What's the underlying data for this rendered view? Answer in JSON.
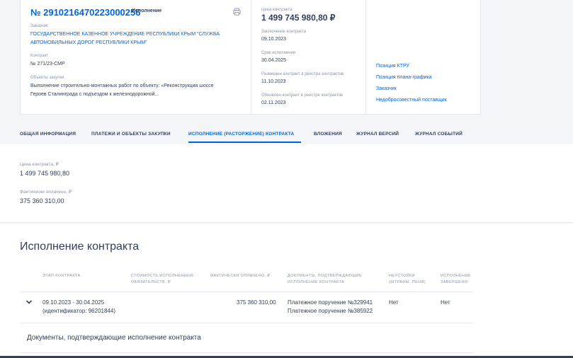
{
  "contract": {
    "number": "№ 2910216470223000256",
    "status": "Исполнение",
    "customer_label": "Заказчик",
    "customer_name_line1": "ГОСУДАРСТВЕННОЕ КАЗЕННОЕ УЧРЕЖДЕНИЕ РЕСПУБЛИКИ КРЫМ \"СЛУЖБА",
    "customer_name_line2": "АВТОМОБИЛЬНЫХ ДОРОГ РЕСПУБЛИКИ КРЫМ\"",
    "contract_label": "Контракт",
    "contract_value": "№ 271/23-СМР",
    "objects_label": "Объекты закупки",
    "objects_line1": "Выполнение строительно-монтажных работ по объекту: «Реконструкция шоссе",
    "objects_line2": "Героев Сталинграда с подъездом к железнодорожной..."
  },
  "details": {
    "price_label": "Цена контракта",
    "price_value": "1 499 745 980,80 ₽",
    "concluded_label": "Заключение контракта",
    "concluded_value": "09.10.2023",
    "term_label": "Срок исполнения",
    "term_value": "30.04.2025",
    "registry_label": "Размещен контракт в реестре контрактов",
    "registry_value": "11.10.2023",
    "updated_label": "Обновлен контракт в реестре контрактов",
    "updated_value": "02.11.2023"
  },
  "links": [
    "Позиция КТРУ",
    "Позиция плана-графика",
    "Заказчик",
    "Недобросовестный поставщик"
  ],
  "tabs": [
    "ОБЩАЯ ИНФОРМАЦИЯ",
    "ПЛАТЕЖИ И ОБЪЕКТЫ ЗАКУПКИ",
    "ИСПОЛНЕНИЕ (РАСТОРЖЕНИЕ) КОНТРАКТА",
    "ВЛОЖЕНИЯ",
    "ЖУРНАЛ ВЕРСИЙ",
    "ЖУРНАЛ СОБЫТИЙ"
  ],
  "summary": {
    "price_label": "Цена контракта, ₽",
    "price_value": "1 499 745 980,80",
    "paid_label": "Фактически оплачено, ₽",
    "paid_value": "375 360 310,00"
  },
  "execution": {
    "title": "Исполнение контракта",
    "headers": {
      "stage": "ЭТАП КОНТРАКТА",
      "cost_line1": "СТОИМОСТЬ ИСПОЛНЕННЫХ",
      "cost_line2": "ОБЯЗАТЕЛЬСТВ, ₽",
      "paid": "ФАКТИЧЕСКИ ОПЛАЧЕНО, ₽",
      "docs_line1": "ДОКУМЕНТЫ, ПОДТВЕРЖДАЮЩИЕ",
      "docs_line2": "ИСПОЛНЕНИЕ КОНТРАКТА",
      "penalty_line1": "НЕУСТОЙКИ",
      "penalty_line2": "(ШТРАФЫ, ПЕНИ)",
      "done_line1": "ИСПОЛНЕНИЕ",
      "done_line2": "ЗАВЕРШЕНО"
    },
    "row": {
      "stage_line1": "09.10.2023 - 30.04.2025",
      "stage_line2": "(идентификатор: 96201844)",
      "paid": "375 360 310,00",
      "doc1": "Платежное поручение №329941",
      "doc2": "Платежное поручение №385922",
      "penalty": "Нет",
      "done": "Нет"
    },
    "docs_title": "Документы, подтверждающие исполнение контракта"
  }
}
